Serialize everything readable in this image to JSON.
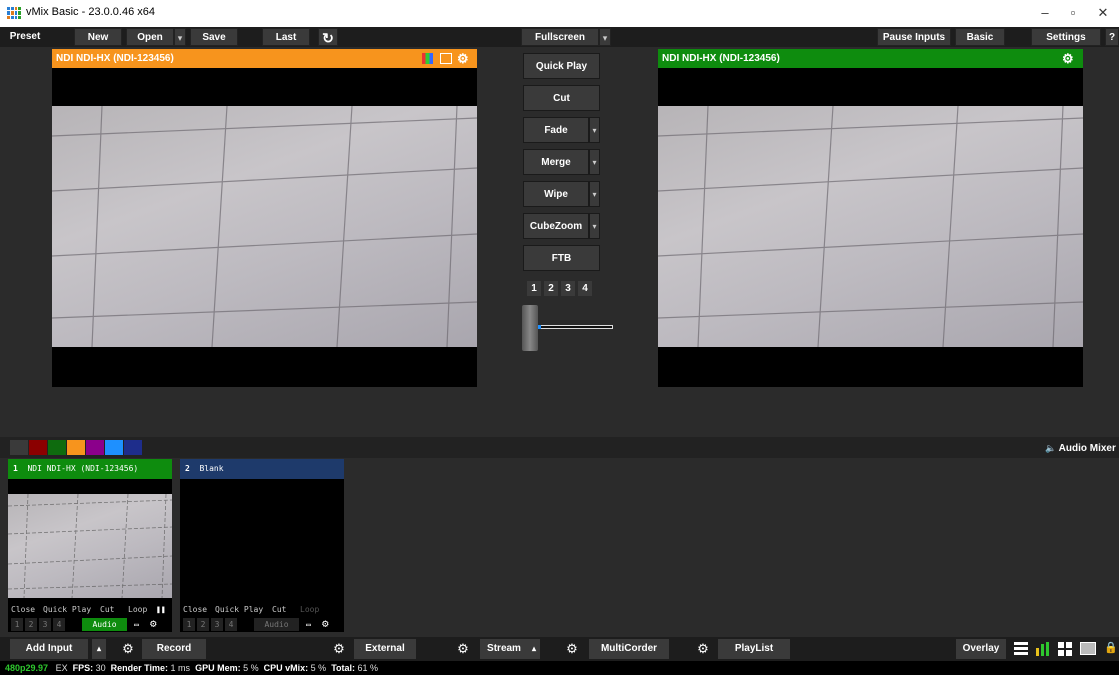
{
  "window": {
    "title": "vMix Basic - 23.0.0.46 x64",
    "minimize": "–",
    "maximize": "▫",
    "close": "✕"
  },
  "menubar": {
    "preset": "Preset",
    "new": "New",
    "open": "Open",
    "save": "Save",
    "last": "Last",
    "refresh_icon": "↻",
    "fullscreen": "Fullscreen",
    "pause_inputs": "Pause Inputs",
    "basic": "Basic",
    "settings": "Settings",
    "help": "?"
  },
  "preview": {
    "title": "NDI NDI-HX (NDI-123456)",
    "header_color": "#f7941d"
  },
  "output": {
    "title": "NDI NDI-HX (NDI-123456)",
    "header_color": "#0e8c0e"
  },
  "transitions": {
    "quick_play": "Quick Play",
    "cut": "Cut",
    "fade": "Fade",
    "merge": "Merge",
    "wipe": "Wipe",
    "cubezoom": "CubeZoom",
    "ftb": "FTB",
    "drop_icon": "▾",
    "numbers": [
      "1",
      "2",
      "3",
      "4"
    ],
    "tbar_level": 0.0
  },
  "color_swatches": [
    "#3a3a3a",
    "#8b0000",
    "#0e6b0e",
    "#f7941d",
    "#8b008b",
    "#1e90ff",
    "#1e2d8b"
  ],
  "audio_mixer": {
    "icon": "🔈",
    "label": "Audio Mixer"
  },
  "inputs": [
    {
      "number": "1",
      "name": "NDI NDI-HX (NDI-123456)",
      "header_color": "#0e8c0e",
      "controls": [
        "Close",
        "Quick Play",
        "Cut",
        "Loop"
      ],
      "pause_icon": "❚❚",
      "layer_numbers": [
        "1",
        "2",
        "3",
        "4"
      ],
      "audio": "Audio",
      "audio_color": "#0e8c0e"
    },
    {
      "number": "2",
      "name": "Blank",
      "header_color": "#1e3a6b",
      "controls": [
        "Close",
        "Quick Play",
        "Cut",
        "Loop"
      ],
      "layer_numbers": [
        "1",
        "2",
        "3",
        "4"
      ],
      "audio": "Audio",
      "audio_color": "#222222"
    }
  ],
  "bottombar": {
    "add_input": "Add Input",
    "record": "Record",
    "external": "External",
    "stream": "Stream",
    "multicorder": "MultiCorder",
    "playlist": "PlayList",
    "overlay": "Overlay",
    "gear_icon": "⚙",
    "drop_icon": "▴",
    "lock_icon": "🔒"
  },
  "status": {
    "format": "480p29.97",
    "ex": "EX",
    "fps_label": "FPS:",
    "fps_value": "30",
    "render_label": "Render Time:",
    "render_value": "1 ms",
    "gpu_label": "GPU Mem:",
    "gpu_value": "5 %",
    "cpu_label": "CPU vMix:",
    "cpu_value": "5 %",
    "total_label": "Total:",
    "total_value": "61 %"
  }
}
